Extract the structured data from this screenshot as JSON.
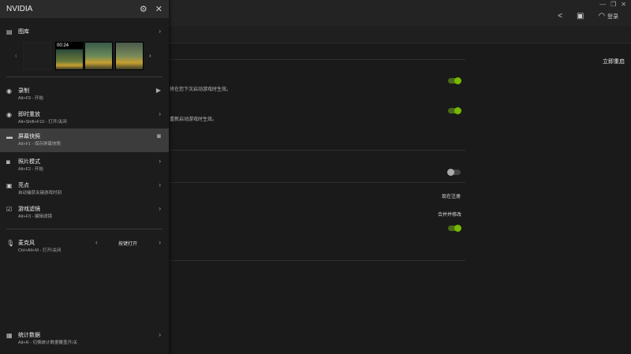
{
  "window": {
    "minimize": "—",
    "restore": "❐",
    "close": "✕"
  },
  "toolbar": {
    "login": "登录",
    "restart_now": "立即重启"
  },
  "panel": {
    "title": "NVIDIA",
    "gallery": {
      "label": "图库",
      "duration": "00:24"
    },
    "items": [
      {
        "label": "录制",
        "sub": "Alt+F9 - 开始"
      },
      {
        "label": "即时重放",
        "sub": "Alt+Shift+F10 - 打开/关闭"
      },
      {
        "label": "屏幕快照",
        "sub": "Alt+F1 - 保存屏幕快照"
      },
      {
        "label": "照片模式",
        "sub": "Alt+F2 - 开始"
      },
      {
        "label": "亮点",
        "sub": "自动捕获关键游戏时刻"
      },
      {
        "label": "游戏滤镜",
        "sub": "Alt+F3 - 编辑滤镜"
      },
      {
        "label": "麦克风",
        "sub": "Ctrl+Alt+M - 打开/关闭",
        "value": "按键打开"
      },
      {
        "label": "统计数据",
        "sub": "Alt+R - 切换统计数据覆盖开/关"
      }
    ]
  },
  "settings": {
    "row1": "将在您下次启动游戏时生效。",
    "row2": "重新启动游戏时生效。",
    "register_now": "现在注册",
    "merge": "合并并修改",
    "toggles": [
      true,
      true,
      false,
      true
    ]
  }
}
